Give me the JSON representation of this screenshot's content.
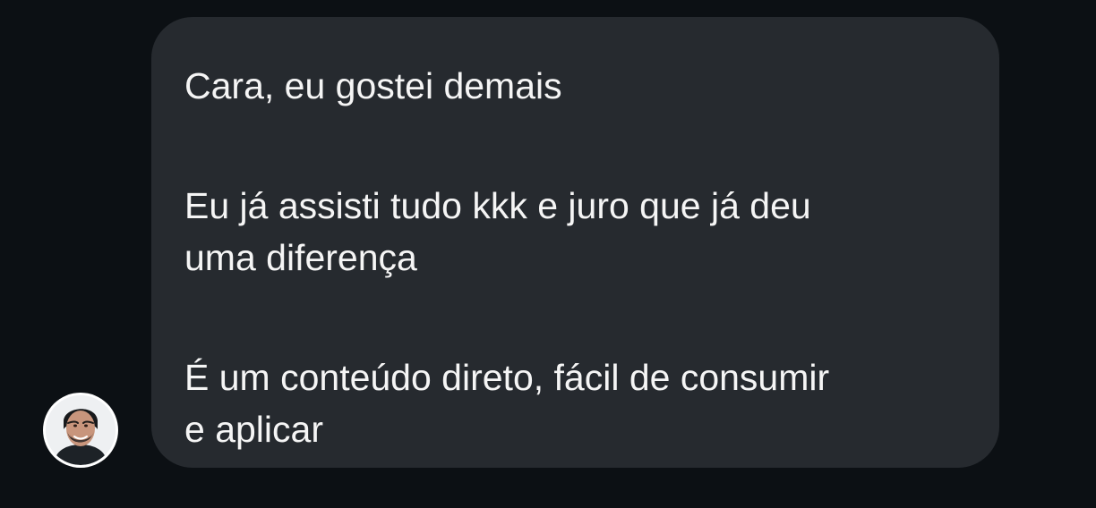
{
  "message": {
    "paragraphs": [
      {
        "lines": [
          "Cara, eu gostei demais"
        ]
      },
      {
        "lines": [
          "Eu já assisti tudo kkk e juro que já deu",
          "uma diferença"
        ]
      },
      {
        "lines": [
          "É um conteúdo direto, fácil de consumir",
          "e aplicar"
        ]
      }
    ]
  },
  "colors": {
    "background": "#0c1014",
    "bubble": "#262a2f",
    "text": "#f5f5f5",
    "avatar_border": "#ffffff"
  },
  "icons": {
    "avatar": "profile-avatar"
  }
}
